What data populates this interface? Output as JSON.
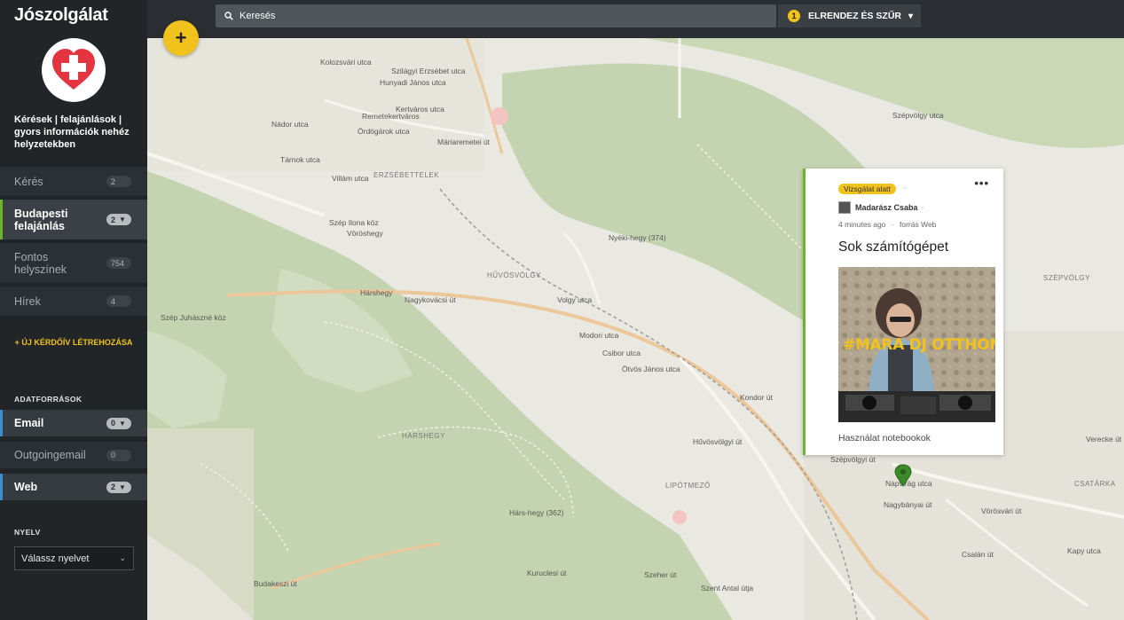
{
  "app": {
    "title": "Jószolgálat",
    "description": "Kérések | felajánlások | gyors információk nehéz helyzetekben"
  },
  "sidebar": {
    "items": [
      {
        "label": "Kérés",
        "count": "2"
      },
      {
        "label": "Budapesti felajánlás",
        "count": "2"
      },
      {
        "label": "Fontos helyszínek",
        "count": "754"
      },
      {
        "label": "Hírek",
        "count": "4"
      }
    ],
    "new_survey_label": "+ ÚJ KÉRDŐÍV LÉTREHOZÁSA",
    "data_sources_heading": "ADATFORRÁSOK",
    "data_sources": [
      {
        "label": "Email",
        "count": "0"
      },
      {
        "label": "Outgoingemail",
        "count": "0"
      },
      {
        "label": "Web",
        "count": "2"
      }
    ],
    "language_heading": "NYELV",
    "language_select": "Válassz nyelvet"
  },
  "topbar": {
    "search_placeholder": "Keresés",
    "sort_badge": "1",
    "sort_label": "ELRENDEZ ÉS SZŰR"
  },
  "fab": {
    "label": "+"
  },
  "post_card": {
    "status": "Vizsgálat alatt",
    "more_label": "•••",
    "author": "Madarász Csaba",
    "time": "4 minutes ago",
    "source": "forrás Web",
    "title": "Sok számítógépet",
    "image_text": "#MARA DJ OTTHON",
    "caption": "Használat notebookok"
  },
  "map": {
    "labels": [
      "Kolozsvári utca",
      "Szilágyi Erzsébet utca",
      "Hunyadi János utca",
      "Kertváros utca",
      "Máriaremetei út",
      "Ördögárok utca",
      "Nádor utca",
      "Tárnok utca",
      "Villám utca",
      "ERZSÉBETTELEK",
      "HŰVÖSVÖLGY",
      "Nagykovácsi út",
      "Hárshegy",
      "Szép Juhászné köz",
      "HÁRSHEGY",
      "Nyéki-hegy (374)",
      "Vöröshegy",
      "SZÉPVÖLGY",
      "Kondor út",
      "Szépvölgyi út",
      "LIPÓTMEZŐ",
      "Napvirág utca",
      "Nagybányai út",
      "Vörösvári út",
      "Csalán út",
      "Kapy utca",
      "Verecke út",
      "CSATÁRKA",
      "Hárs-hegy (362)",
      "Budakeszi út",
      "Szeher út",
      "Szent Antal útja",
      "Kuruclesi út",
      "Volgy utca",
      "Modori utca",
      "Csibor utca",
      "Ötvös János utca",
      "Hűvösvölgyi út",
      "Remetekertváros",
      "Szépvölgy utca",
      "Szép Ilona köz"
    ]
  }
}
